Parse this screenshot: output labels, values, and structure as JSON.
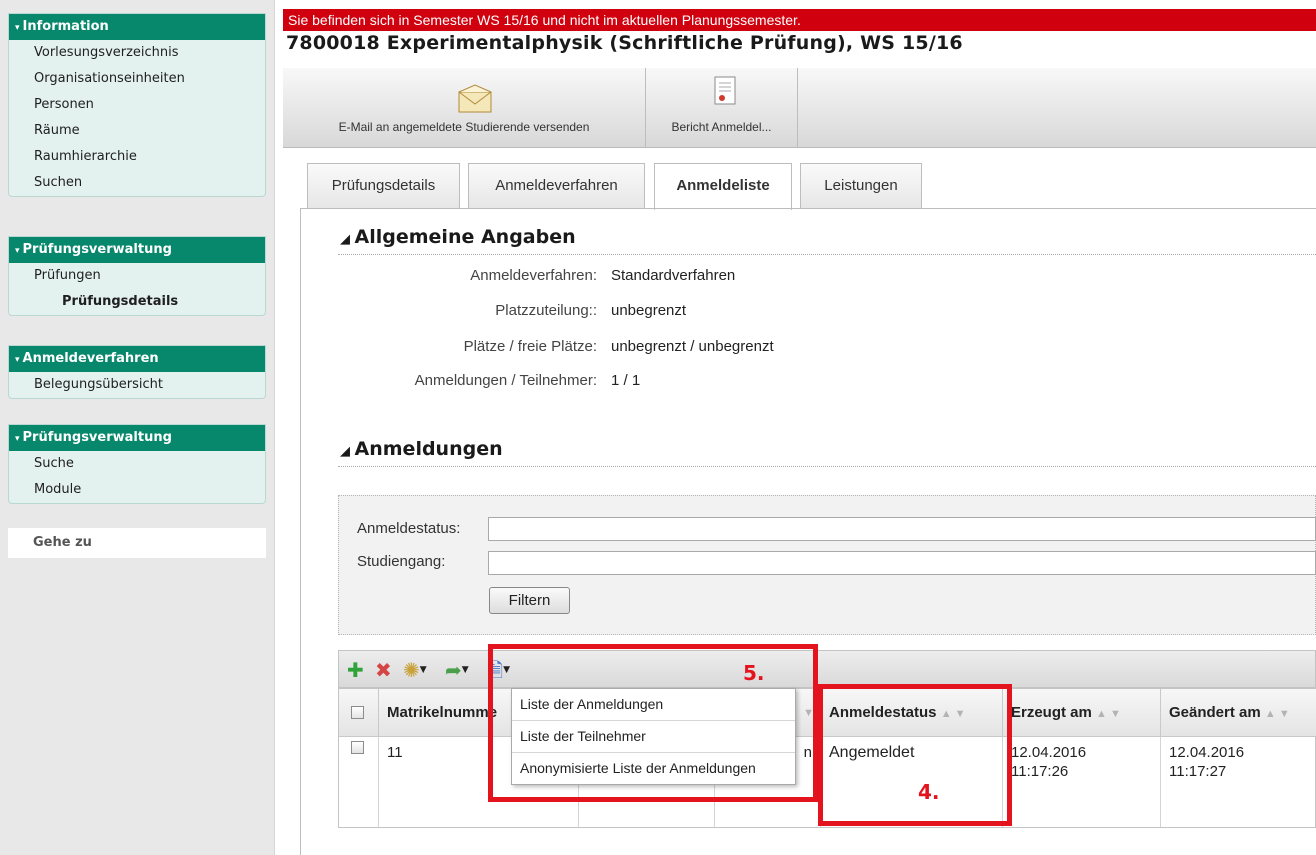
{
  "sidebar": {
    "sections": [
      {
        "title": "Information",
        "items": [
          "Vorlesungsverzeichnis",
          "Organisationseinheiten",
          "Personen",
          "Räume",
          "Raumhierarchie",
          "Suchen"
        ]
      },
      {
        "title": "Prüfungsverwaltung",
        "items": [
          "Prüfungen"
        ],
        "sub_item": "Prüfungsdetails"
      },
      {
        "title": "Anmeldeverfahren",
        "items": [
          "Belegungsübersicht"
        ]
      },
      {
        "title": "Prüfungsverwaltung",
        "items": [
          "Suche",
          "Module"
        ]
      }
    ],
    "goto_label": "Gehe zu"
  },
  "banner": "Sie befinden sich in Semester WS 15/16 und nicht im aktuellen Planungssemester.",
  "page_title": "7800018 Experimentalphysik (Schriftliche Prüfung), WS 15/16",
  "toolbar": {
    "email_label": "E-Mail an angemeldete Studierende versenden",
    "report_label": "Bericht Anmeldel..."
  },
  "tabs": [
    "Prüfungsdetails",
    "Anmeldeverfahren",
    "Anmeldeliste",
    "Leistungen"
  ],
  "active_tab": "Anmeldeliste",
  "general": {
    "title": "Allgemeine Angaben",
    "rows": [
      {
        "label": "Anmeldeverfahren:",
        "value": "Standardverfahren"
      },
      {
        "label": "Platzzuteilung::",
        "value": "unbegrenzt"
      },
      {
        "label": "Plätze / freie Plätze:",
        "value": "unbegrenzt / unbegrenzt"
      },
      {
        "label": "Anmeldungen / Teilnehmer:",
        "value": "1 / 1"
      }
    ]
  },
  "registrations": {
    "title": "Anmeldungen",
    "filter": {
      "status_label": "Anmeldestatus:",
      "program_label": "Studiengang:",
      "button": "Filtern"
    },
    "columns": [
      "Matrikelnumme",
      "Anmeldestatus",
      "Erzeugt am",
      "Geändert am"
    ],
    "row": {
      "matrikel": "11",
      "hidden_tail": "n",
      "status": "Angemeldet",
      "created_date": "12.04.2016",
      "created_time": "11:17:26",
      "changed_date": "12.04.2016",
      "changed_time": "11:17:27"
    },
    "dropdown": [
      "Liste der Anmeldungen",
      "Liste der Teilnehmer",
      "Anonymisierte Liste der Anmeldungen"
    ]
  },
  "annotations": {
    "box5": "5.",
    "box4": "4."
  },
  "colors": {
    "nav_head": "#07876b",
    "banner": "#d1000e",
    "annotation": "#e3141e"
  }
}
